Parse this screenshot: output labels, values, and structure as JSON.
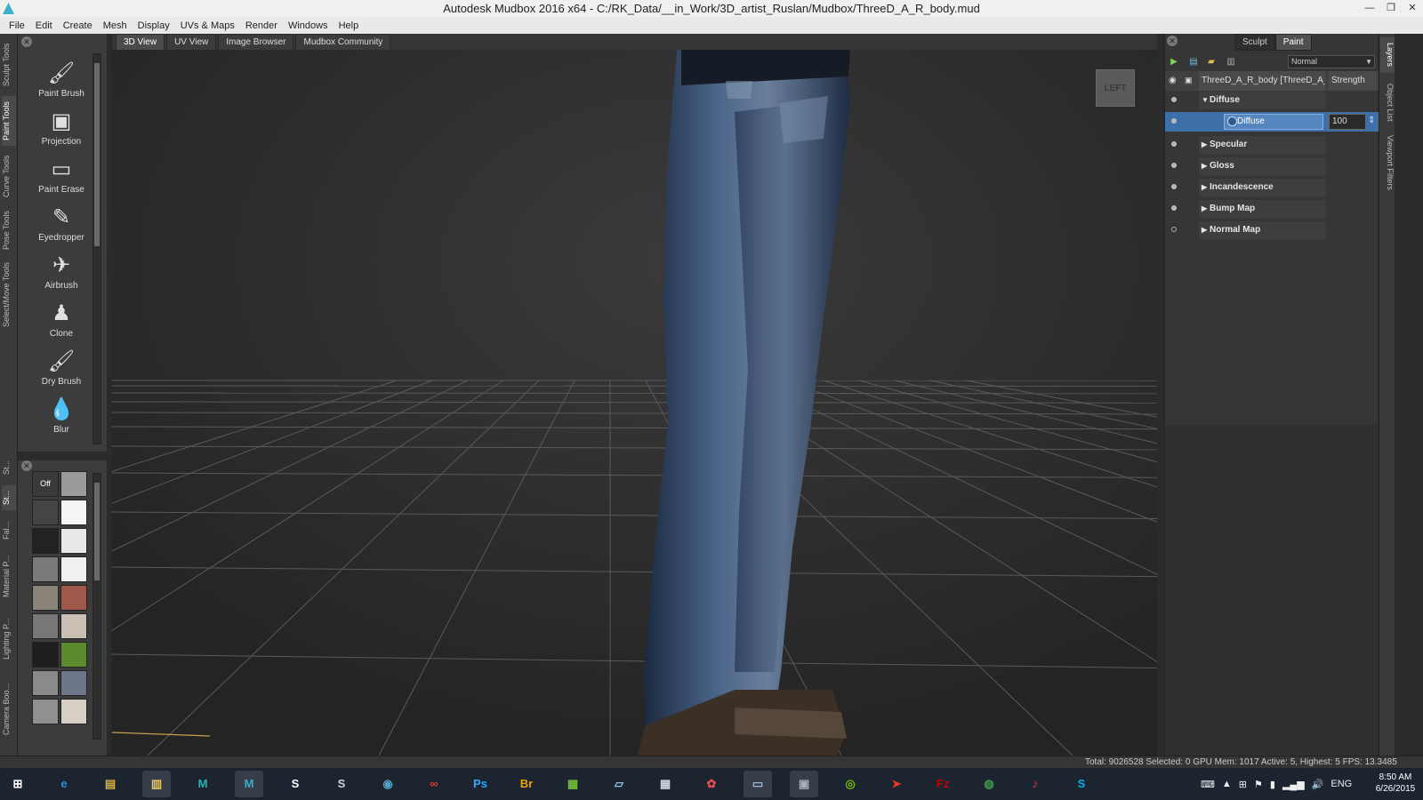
{
  "window": {
    "title": "Autodesk Mudbox 2016 x64 - C:/RK_Data/__in_Work/3D_artist_Ruslan/Mudbox/ThreeD_A_R_body.mud"
  },
  "menu": [
    "File",
    "Edit",
    "Create",
    "Mesh",
    "Display",
    "UVs & Maps",
    "Render",
    "Windows",
    "Help"
  ],
  "left_tabs": [
    "Sculpt Tools",
    "Paint Tools",
    "Curve Tools",
    "Pose Tools",
    "Select/Move Tools"
  ],
  "lower_tabs": [
    "St...",
    "St...",
    "Fal...",
    "Material P...",
    "Lighting P...",
    "Camera Boo..."
  ],
  "tools": [
    {
      "label": "Paint Brush",
      "icon": "paint-brush-icon",
      "glyph": "🖌"
    },
    {
      "label": "Projection",
      "icon": "projection-icon",
      "glyph": "▣"
    },
    {
      "label": "Paint Erase",
      "icon": "paint-erase-icon",
      "glyph": "▭"
    },
    {
      "label": "Eyedropper",
      "icon": "eyedropper-icon",
      "glyph": "✎"
    },
    {
      "label": "Airbrush",
      "icon": "airbrush-icon",
      "glyph": "✈"
    },
    {
      "label": "Clone",
      "icon": "clone-icon",
      "glyph": "♟"
    },
    {
      "label": "Dry Brush",
      "icon": "dry-brush-icon",
      "glyph": "🖌"
    },
    {
      "label": "Blur",
      "icon": "blur-icon",
      "glyph": "💧"
    }
  ],
  "stamps": {
    "off_label": "Off",
    "colors": [
      "#3a3a3a",
      "#9a9a9a",
      "#444",
      "#f5f5f5",
      "#222",
      "#e8e8e8",
      "#7a7a7a",
      "#f0f0f0",
      "#8a8378",
      "#a0584a",
      "#777",
      "#c9bfb3",
      "#1e1e1e",
      "#5c8a2f",
      "#8a8a8a",
      "#6d7588",
      "#909090",
      "#d8d0c4"
    ]
  },
  "viewport": {
    "tabs": [
      "3D View",
      "UV View",
      "Image Browser",
      "Mudbox Community"
    ],
    "viewcube_label": "LEFT"
  },
  "right_panel": {
    "mode_tabs": [
      "Sculpt",
      "Paint"
    ],
    "blend_mode": "Normal",
    "object_name": "ThreeD_A_R_body [ThreeD_A_R_",
    "strength_label": "Strength",
    "channels": [
      {
        "name": "Diffuse",
        "expanded": true,
        "visible": true
      },
      {
        "name": "Specular",
        "expanded": false,
        "visible": true
      },
      {
        "name": "Gloss",
        "expanded": false,
        "visible": true
      },
      {
        "name": "Incandescence",
        "expanded": false,
        "visible": true
      },
      {
        "name": "Bump Map",
        "expanded": false,
        "visible": true
      },
      {
        "name": "Normal Map",
        "expanded": false,
        "visible": false
      }
    ],
    "selected_layer": {
      "name": "Diffuse",
      "strength": "100"
    }
  },
  "right_tabs": [
    "Layers",
    "Object List",
    "Viewport Filters"
  ],
  "status": {
    "text": "Total: 9026528  Selected: 0 GPU Mem: 1017  Active: 5, Highest: 5  FPS: 13.3485"
  },
  "taskbar": {
    "apps": [
      {
        "name": "windows-start",
        "glyph": "⊞",
        "color": "#ffffff"
      },
      {
        "name": "internet-explorer",
        "glyph": "e",
        "color": "#2e8fd6"
      },
      {
        "name": "file-manager",
        "glyph": "▤",
        "color": "#d8b048"
      },
      {
        "name": "explorer",
        "glyph": "▥",
        "color": "#e8c560"
      },
      {
        "name": "autodesk-app-1",
        "glyph": "M",
        "color": "#2bb3b3"
      },
      {
        "name": "mudbox",
        "glyph": "M",
        "color": "#38b0c8"
      },
      {
        "name": "obs",
        "glyph": "S",
        "color": "#ffffff"
      },
      {
        "name": "steam",
        "glyph": "S",
        "color": "#cfd6de"
      },
      {
        "name": "browser-globe",
        "glyph": "◉",
        "color": "#56a0c8"
      },
      {
        "name": "creative-cloud",
        "glyph": "∞",
        "color": "#e23a2a"
      },
      {
        "name": "photoshop",
        "glyph": "Ps",
        "color": "#31a8ff"
      },
      {
        "name": "bridge",
        "glyph": "Br",
        "color": "#e8a200"
      },
      {
        "name": "spreadsheet",
        "glyph": "▦",
        "color": "#6fbf3a"
      },
      {
        "name": "notes",
        "glyph": "▱",
        "color": "#8cc8e8"
      },
      {
        "name": "calculator",
        "glyph": "▦",
        "color": "#cfd6de"
      },
      {
        "name": "paint-tool",
        "glyph": "✿",
        "color": "#e05050"
      },
      {
        "name": "remote-desktop",
        "glyph": "▭",
        "color": "#9ab8d8"
      },
      {
        "name": "image-viewer",
        "glyph": "▣",
        "color": "#aab0b8"
      },
      {
        "name": "nvidia",
        "glyph": "◎",
        "color": "#76b900"
      },
      {
        "name": "red-arrow-app",
        "glyph": "➤",
        "color": "#e8342a"
      },
      {
        "name": "filezilla",
        "glyph": "Fz",
        "color": "#bf0000"
      },
      {
        "name": "earth-app",
        "glyph": "◍",
        "color": "#3a9a4a"
      },
      {
        "name": "itunes",
        "glyph": "♪",
        "color": "#ff2d55"
      },
      {
        "name": "skype",
        "glyph": "S",
        "color": "#00aff0"
      }
    ],
    "tray": {
      "lang": "ENG",
      "time": "8:50 AM",
      "date": "6/26/2015"
    }
  }
}
